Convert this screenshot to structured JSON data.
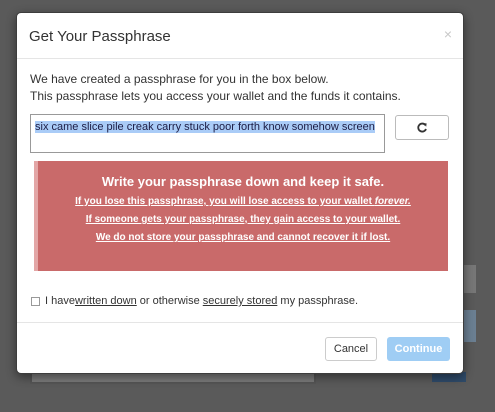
{
  "dialog": {
    "title": "Get Your Passphrase",
    "close_glyph": "×",
    "intro_line1": "We have created a passphrase for you in the box below.",
    "intro_line2": "This passphrase lets you access your wallet and the funds it contains.",
    "passphrase": "six came slice pile creak carry stuck poor forth know somehow screen",
    "refresh_icon": "refresh-icon"
  },
  "warning": {
    "title": "Write your passphrase down and keep it safe.",
    "line1_a": "If you lose this passphrase, you will lose access to your wallet ",
    "line1_b": "forever.",
    "line2": "If someone gets your passphrase, they gain access to your wallet.",
    "line3": "We do not store your passphrase and cannot recover it if lost.",
    "color": "#c96a6a"
  },
  "confirm": {
    "text_a": "I have ",
    "link1": "written down",
    "text_b": " or otherwise ",
    "link2": "securely stored",
    "text_c": " my passphrase.",
    "checked": false
  },
  "footer": {
    "cancel_label": "Cancel",
    "continue_label": "Continue",
    "continue_color": "#9fcdf4"
  }
}
